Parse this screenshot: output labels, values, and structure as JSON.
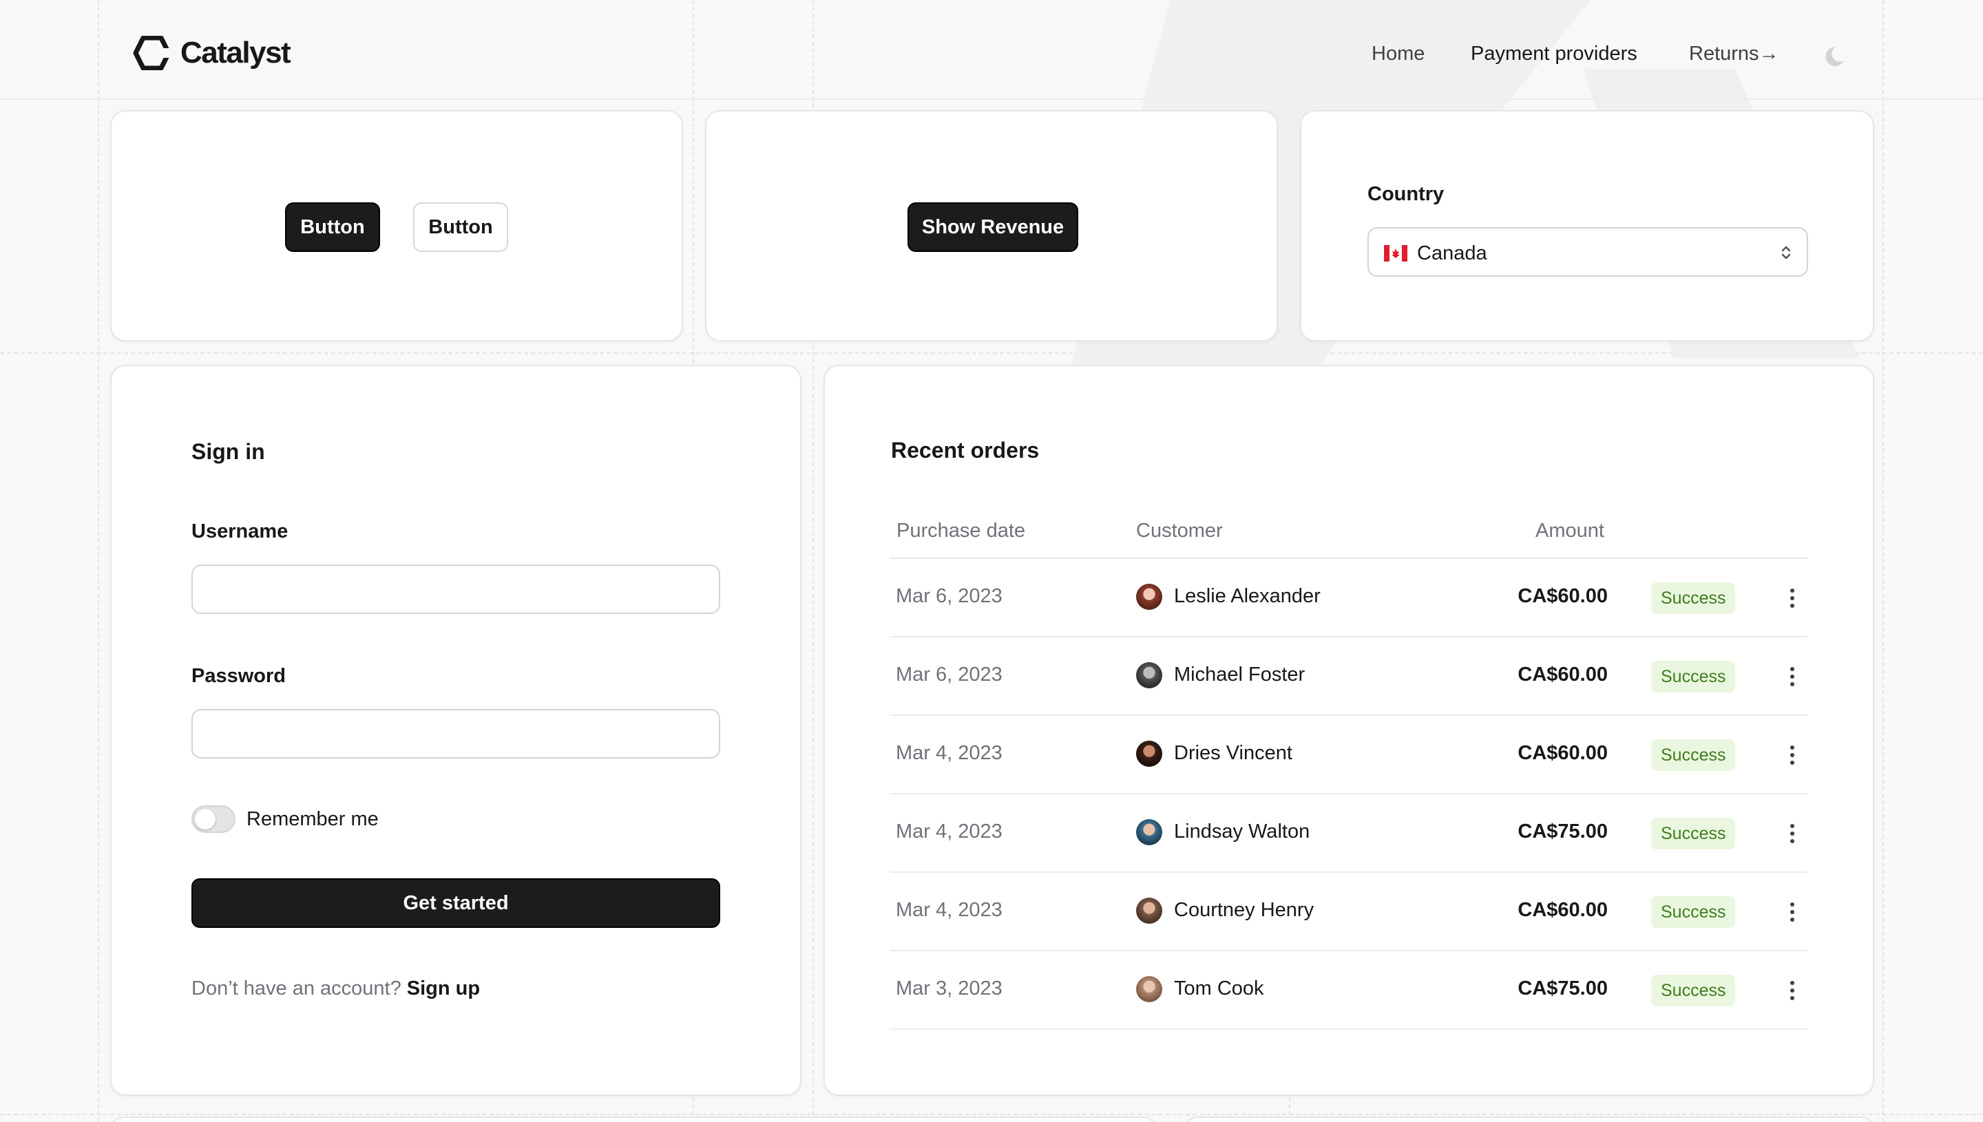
{
  "brand": {
    "name": "Catalyst"
  },
  "nav": {
    "home": "Home",
    "payment_providers": "Payment providers",
    "returns": "Returns",
    "returns_arrow": "→"
  },
  "buttons_card": {
    "primary_label": "Button",
    "secondary_label": "Button"
  },
  "revenue_card": {
    "label": "Show Revenue"
  },
  "country_card": {
    "label": "Country",
    "selected": "Canada"
  },
  "signin": {
    "title": "Sign in",
    "username_label": "Username",
    "username_value": "",
    "password_label": "Password",
    "password_value": "",
    "remember_label": "Remember me",
    "remember_checked": false,
    "submit_label": "Get started",
    "no_account_text": "Don’t have an account?",
    "signup_link": "Sign up"
  },
  "orders": {
    "title": "Recent orders",
    "columns": [
      "Purchase date",
      "Customer",
      "Amount"
    ],
    "rows": [
      {
        "date": "Mar 6, 2023",
        "customer": "Leslie Alexander",
        "amount": "CA$60.00",
        "status": "Success"
      },
      {
        "date": "Mar 6, 2023",
        "customer": "Michael Foster",
        "amount": "CA$60.00",
        "status": "Success"
      },
      {
        "date": "Mar 4, 2023",
        "customer": "Dries Vincent",
        "amount": "CA$60.00",
        "status": "Success"
      },
      {
        "date": "Mar 4, 2023",
        "customer": "Lindsay Walton",
        "amount": "CA$75.00",
        "status": "Success"
      },
      {
        "date": "Mar 4, 2023",
        "customer": "Courtney Henry",
        "amount": "CA$60.00",
        "status": "Success"
      },
      {
        "date": "Mar 3, 2023",
        "customer": "Tom Cook",
        "amount": "CA$75.00",
        "status": "Success"
      }
    ]
  },
  "colors": {
    "primary_button": "#1c1c1e",
    "success_badge_bg": "#eaf6df",
    "success_badge_text": "#3f7d1e"
  },
  "icons": {
    "logo": "catalyst-logo-icon",
    "theme_toggle": "moon-icon",
    "country_flag": "canada-flag-icon",
    "select_chevron": "chevron-up-down-icon",
    "row_menu": "ellipsis-vertical-icon"
  }
}
